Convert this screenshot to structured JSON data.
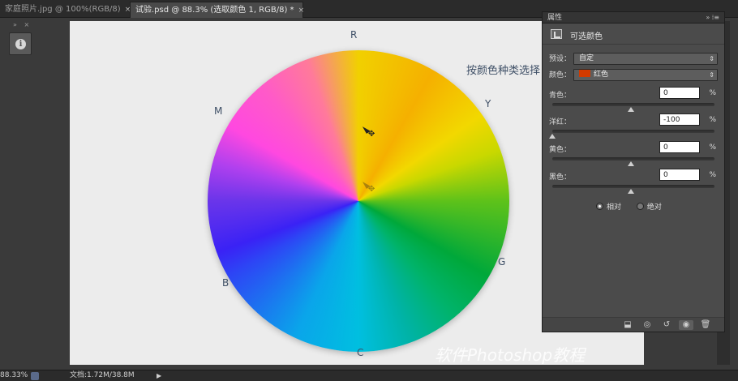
{
  "tabs": [
    {
      "label": "家庭照片.jpg @ 100%(RGB/8)",
      "close": "×"
    },
    {
      "label": "试验.psd @ 88.3% (选取颜色 1, RGB/8) *",
      "close": "×"
    }
  ],
  "left_panel": {
    "header": "»  ×",
    "info_icon_glyph": "i"
  },
  "canvas": {
    "wheel_labels": {
      "top": "R",
      "top_right": "Y",
      "right": "G",
      "bottom": "C",
      "left": "B",
      "top_left": "M"
    },
    "hint": "按颜色种类选择",
    "watermark": "软件Photoshop教程",
    "move_glyph": "✥"
  },
  "properties": {
    "title": "属性",
    "title_controls": "»  ⁞≡",
    "header": "可选颜色",
    "preset_label": "预设：",
    "preset_value": "自定",
    "colors_label": "颜色：",
    "colors_value": "红色",
    "colors_swatch": "#d23a00",
    "dropdown_arrow": "⇕",
    "sliders": [
      {
        "label": "青色：",
        "value": "0",
        "unit": "%",
        "level": 0
      },
      {
        "label": "洋红：",
        "value": "-100",
        "unit": "%",
        "level": -100
      },
      {
        "label": "黄色：",
        "value": "0",
        "unit": "%",
        "level": 0
      },
      {
        "label": "黑色：",
        "value": "0",
        "unit": "%",
        "level": 0
      }
    ],
    "method_relative": "相对",
    "method_absolute": "绝对",
    "footer_icons": [
      "clip-to-layer-icon",
      "view-previous-icon",
      "reset-icon",
      "visibility-eye-icon",
      "trash-icon"
    ]
  },
  "status": {
    "zoom": "88.33%",
    "doc": "文档:1.72M/38.8M",
    "play": "▶"
  }
}
